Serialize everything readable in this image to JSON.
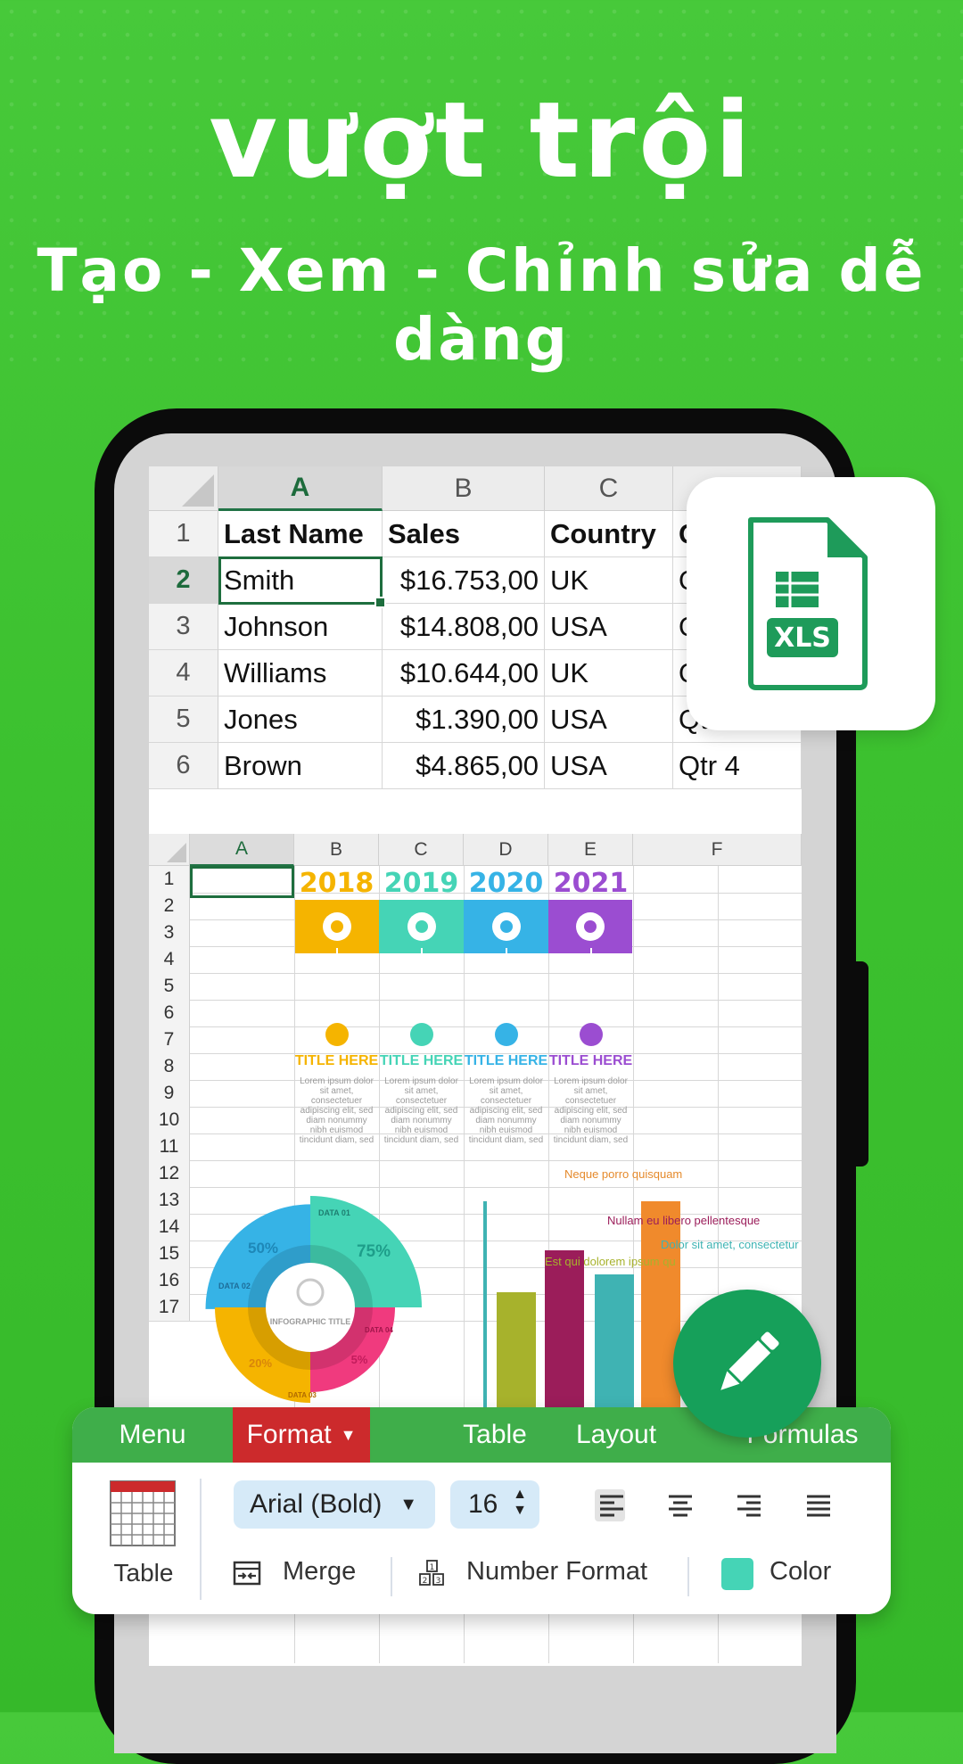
{
  "headline": {
    "title": "vượt trội",
    "subtitle": "Tạo - Xem - Chỉnh sửa dễ dàng"
  },
  "sheet1": {
    "columns": [
      "A",
      "B",
      "C",
      ""
    ],
    "rows": [
      {
        "num": "1",
        "cells": [
          "Last Name",
          "Sales",
          "Country",
          "Q"
        ]
      },
      {
        "num": "2",
        "cells": [
          "Smith",
          "$16.753,00",
          "UK",
          "Q"
        ]
      },
      {
        "num": "3",
        "cells": [
          "Johnson",
          "$14.808,00",
          "USA",
          "Q"
        ]
      },
      {
        "num": "4",
        "cells": [
          "Williams",
          "$10.644,00",
          "UK",
          "Q"
        ]
      },
      {
        "num": "5",
        "cells": [
          "Jones",
          "$1.390,00",
          "USA",
          "Qtr 3"
        ]
      },
      {
        "num": "6",
        "cells": [
          "Brown",
          "$4.865,00",
          "USA",
          "Qtr 4"
        ]
      }
    ]
  },
  "sheet2": {
    "columns": [
      "A",
      "B",
      "C",
      "D",
      "E",
      "F"
    ],
    "rows": [
      "1",
      "2",
      "3",
      "4",
      "5",
      "6",
      "7",
      "8",
      "9",
      "10",
      "11",
      "12",
      "13",
      "14",
      "15",
      "16",
      "17"
    ],
    "years": [
      {
        "year": "2018",
        "color": "#f5b400"
      },
      {
        "year": "2019",
        "color": "#45d4b6"
      },
      {
        "year": "2020",
        "color": "#36b3e6"
      },
      {
        "year": "2021",
        "color": "#9b4dd1"
      }
    ],
    "timeline_title": "TITLE HERE",
    "timeline_text": "Lorem ipsum dolor sit amet, consectetuer adipiscing elit, sed diam nonummy nibh euismod tincidunt diam, sed",
    "donut": {
      "center_title": "INFOGRAPHIC TITLE",
      "segments": [
        {
          "label": "DATA 01",
          "value": "75%",
          "color": "#45d4b6"
        },
        {
          "label": "DATA 02",
          "value": "50%",
          "color": "#36b3e6"
        },
        {
          "label": "DATA 03",
          "value": "20%",
          "color": "#f5b400"
        },
        {
          "label": "DATA 04",
          "value": "5%",
          "color": "#f03a7e"
        }
      ]
    },
    "bar_labels": [
      {
        "text": "Neque porro quisquam",
        "color": "#e58a2c"
      },
      {
        "text": "Nullam eu libero pellentesque",
        "color": "#9b1d5a"
      },
      {
        "text": "Dolor sit amet, consectetur",
        "color": "#3fb3b3"
      },
      {
        "text": "Est qui dolorem ipsum qu",
        "color": "#a7b22c"
      }
    ],
    "bars": [
      {
        "value": 0.59,
        "color": "#a7b22c"
      },
      {
        "value": 0.78,
        "color": "#9b1d5a"
      },
      {
        "value": 0.67,
        "color": "#3fb3b3"
      },
      {
        "value": 1.0,
        "color": "#f08a2c"
      }
    ]
  },
  "file_badge": {
    "label": "XLS",
    "color": "#1e9b5a"
  },
  "fab": {
    "icon": "pencil-icon",
    "color": "#16a05a"
  },
  "toolbar": {
    "tabs": [
      "Menu",
      "Format",
      "Table",
      "Layout",
      "Formulas"
    ],
    "active_tab": "Format",
    "table_label": "Table",
    "font_value": "Arial (Bold)",
    "size_value": "16",
    "merge_label": "Merge",
    "number_format_label": "Number Format",
    "color_label": "Color",
    "swatch_color": "#45d4b6",
    "active_tab_color": "#cc2a2c",
    "tabbar_color": "#3fae4a"
  }
}
